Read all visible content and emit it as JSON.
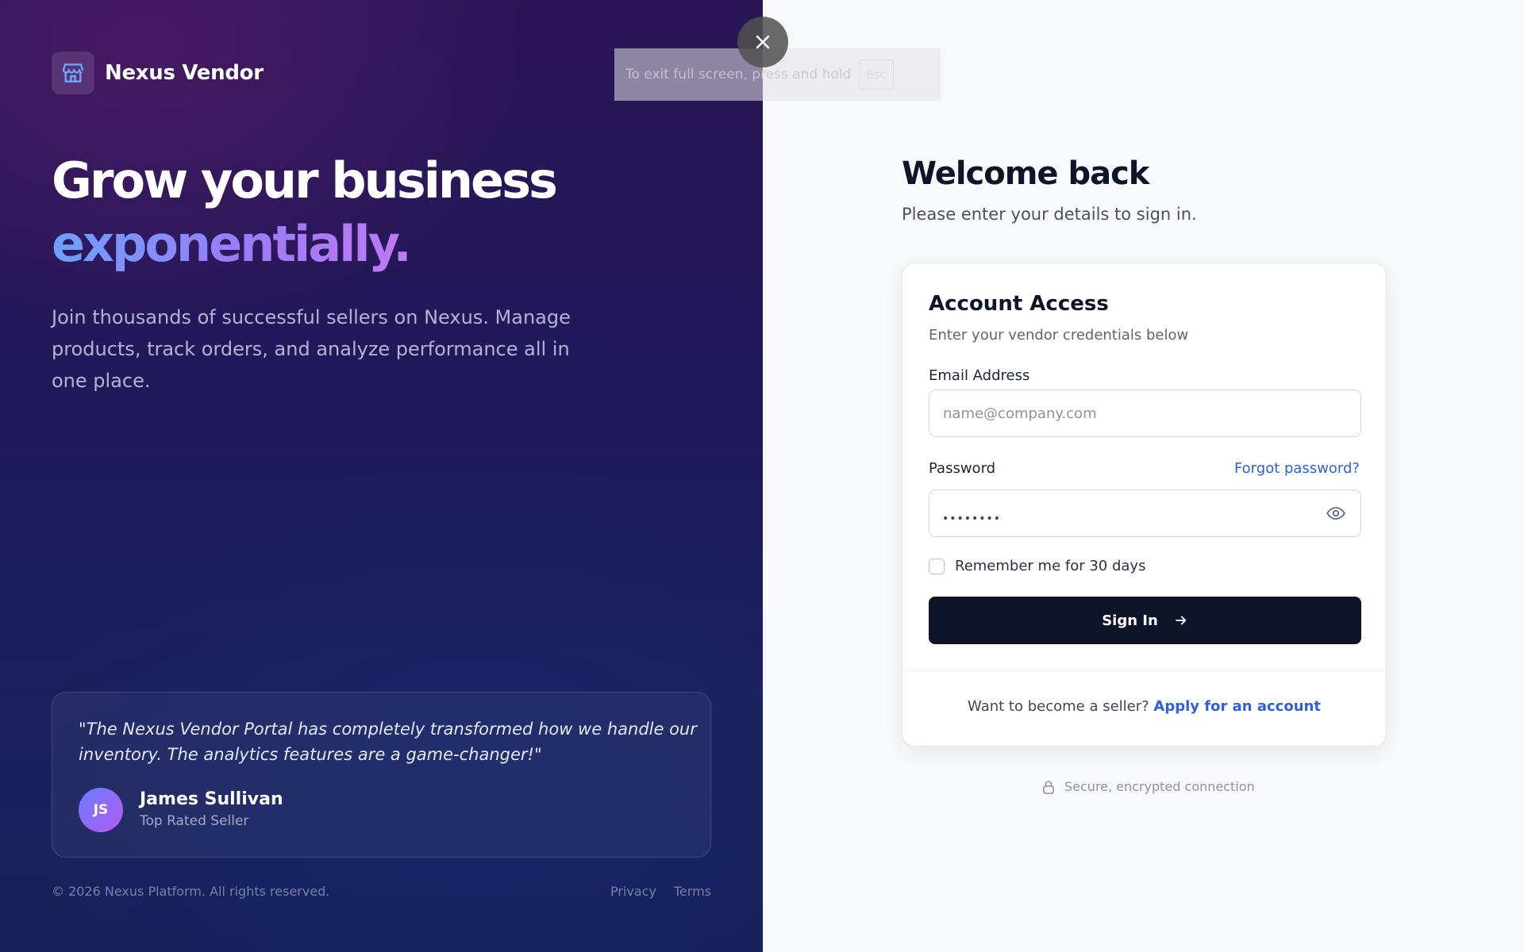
{
  "brand": {
    "name": "Nexus Vendor",
    "icon": "storefront-icon"
  },
  "hero": {
    "headline_line1": "Grow your business",
    "headline_line2": "exponentially.",
    "intro": "Join thousands of successful sellers on Nexus. Manage products, track orders, and analyze performance all in one place."
  },
  "testimonial": {
    "quote": "\"The Nexus Vendor Portal has completely transformed how we handle our inventory. The analytics features are a game-changer!\"",
    "author_initials": "JS",
    "author_name": "James Sullivan",
    "author_role": "Top Rated Seller"
  },
  "footer": {
    "copyright": "© 2026 Nexus Platform. All rights reserved.",
    "links": [
      "Privacy",
      "Terms"
    ]
  },
  "fullscreen_notice": {
    "message": "To exit full screen, press and hold",
    "key": "Esc",
    "close_icon": "close-icon"
  },
  "login": {
    "title": "Welcome back",
    "subtitle": "Please enter your details to sign in.",
    "card_title": "Account Access",
    "card_subtitle": "Enter your vendor credentials below",
    "email_label": "Email Address",
    "email_placeholder": "name@company.com",
    "email_value": "",
    "password_label": "Password",
    "password_value": "••••••••",
    "forgot_label": "Forgot password?",
    "remember_label": "Remember me for 30 days",
    "remember_checked": false,
    "submit_label": "Sign In",
    "footer_question": "Want to become a seller?",
    "footer_link": "Apply for an account",
    "secure_text": "Secure, encrypted connection"
  },
  "colors": {
    "accent_link": "#2f5fe0",
    "button_bg": "#0f1528",
    "left_panel_top": "#2a1656",
    "left_panel_bottom": "#172259",
    "gradient_text_start": "#6ea0ff",
    "gradient_text_end": "#c07af2"
  }
}
